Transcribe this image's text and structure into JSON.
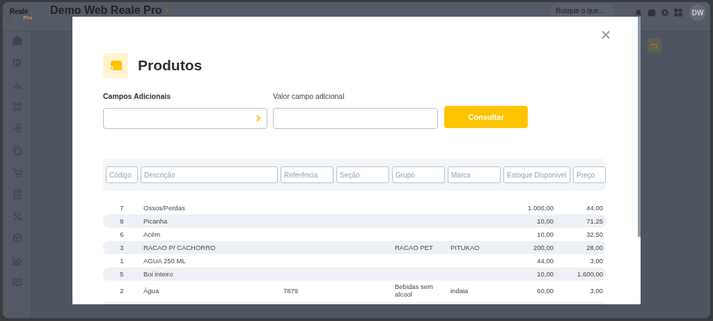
{
  "app": {
    "logo": {
      "name": "Reale",
      "sub": "Pro"
    },
    "title": "Demo Web Reale Pro",
    "search": {
      "placeholder": "Busque o que..."
    },
    "avatar": "DW"
  },
  "modal": {
    "title": "Produtos",
    "fields": [
      {
        "kind": "select",
        "label": "Campos Adicionais"
      },
      {
        "kind": "input",
        "label": "Valor campo adicional"
      }
    ],
    "button": "Consultar",
    "table": {
      "filters": [
        {
          "placeholder": "Código"
        },
        {
          "placeholder": "Descrição"
        },
        {
          "placeholder": "Referência"
        },
        {
          "placeholder": "Seção"
        },
        {
          "placeholder": "Grupo"
        },
        {
          "placeholder": "Marca"
        },
        {
          "placeholder": "Estoque Disponivel"
        },
        {
          "placeholder": "Preço"
        }
      ],
      "rows": [
        {
          "codigo": "7",
          "descricao": "Ossos/Perdas",
          "estoque": "1.000,00",
          "preco": "44,00"
        },
        {
          "codigo": "8",
          "descricao": "Picanha",
          "estoque": "10,00",
          "preco": "71,25"
        },
        {
          "codigo": "6",
          "descricao": "Acém",
          "estoque": "10,00",
          "preco": "32,50"
        },
        {
          "codigo": "3",
          "descricao": "RACAO P/ CACHORRO",
          "grupo": "RACAO PET",
          "marca": "PITUKAO",
          "estoque": "200,00",
          "preco": "28,00"
        },
        {
          "codigo": "1",
          "descricao": "AGUA 250 ML",
          "estoque": "44,00",
          "preco": "3,00"
        },
        {
          "codigo": "5",
          "descricao": "Boi inteiro",
          "estoque": "10,00",
          "preco": "1.600,00"
        },
        {
          "codigo": "2",
          "descricao": "Água",
          "referencia": "7879",
          "grupo": "Bebidas sem alcool",
          "marca": "indaia",
          "estoque": "60,00",
          "preco": "3,00"
        }
      ]
    }
  }
}
